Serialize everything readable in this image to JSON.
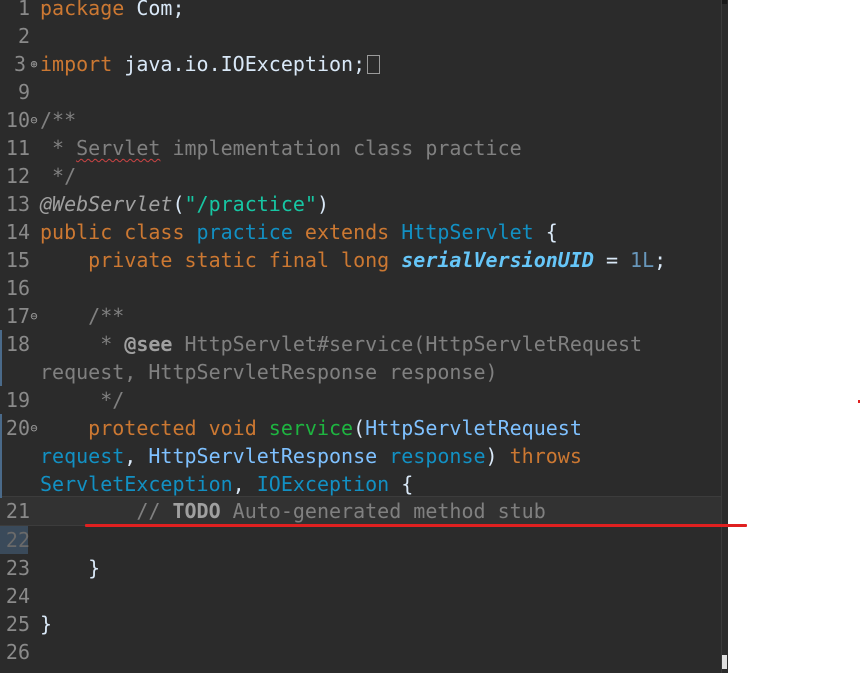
{
  "editor": {
    "lines": {
      "l1": {
        "num": "1",
        "kw": "package",
        "rest": " Com;"
      },
      "l2": {
        "num": "2"
      },
      "l3": {
        "num": "3",
        "kw": "import",
        "rest": " java.io.IOException;"
      },
      "l9": {
        "num": "9"
      },
      "l10": {
        "num": "10",
        "doc": "/**"
      },
      "l11": {
        "num": "11",
        "doc_a": " * ",
        "doc_b": "Servlet",
        "doc_c": " implementation class practice"
      },
      "l12": {
        "num": "12",
        "doc": " */"
      },
      "l13": {
        "num": "13",
        "ann": "@WebServlet",
        "p1": "(",
        "str": "\"/practice\"",
        "p2": ")"
      },
      "l14": {
        "num": "14",
        "kw1": "public class",
        "sp1": " ",
        "cls": "practice",
        "sp2": " ",
        "kw2": "extends",
        "sp3": " ",
        "typ": "HttpServlet",
        "rest": " {"
      },
      "l15": {
        "num": "15",
        "indent": "    ",
        "kw": "private static final long",
        "sp": " ",
        "field": "serialVersionUID",
        "eq": " = ",
        "num_val": "1L",
        "semi": ";"
      },
      "l16": {
        "num": "16"
      },
      "l17": {
        "num": "17",
        "doc": "    /**"
      },
      "l18": {
        "num": "18",
        "doc_a": "     * ",
        "tag": "@see",
        "doc_b": " HttpServlet#service(HttpServletRequest",
        "cont": "request, HttpServletResponse response)"
      },
      "l19": {
        "num": "19",
        "doc": "     */"
      },
      "l20": {
        "num": "20",
        "indent": "    ",
        "kw": "protected void",
        "sp": " ",
        "fn": "service",
        "p1": "(",
        "typ1": "HttpServletRequest",
        "cont1_a": "request",
        "cont1_b": ", ",
        "cont1_typ": "HttpServletResponse",
        "cont1_sp": " ",
        "cont1_param": "response",
        "cont1_c": ") ",
        "cont1_kw": "throws",
        "cont2_typ1": "ServletException",
        "cont2_b": ", ",
        "cont2_typ2": "IOException",
        "cont2_c": " {"
      },
      "l21": {
        "num": "21",
        "indent": "        ",
        "cmt_a": "// ",
        "todo": "TODO",
        "cmt_b": " Auto-generated method stub"
      },
      "l22": {
        "num": "22"
      },
      "l23": {
        "num": "23",
        "text": "    }"
      },
      "l24": {
        "num": "24"
      },
      "l25": {
        "num": "25",
        "text": "}"
      },
      "l26": {
        "num": "26"
      }
    }
  },
  "colors": {
    "background": "#2b2b2b",
    "keyword": "#cc7832",
    "type": "#1290c3",
    "method": "#1eb540",
    "string": "#17c6a3",
    "comment": "#808080",
    "annotation_underline": "#e02020"
  },
  "icons": {
    "fold": "fold-expand-icon",
    "import_collapsed": "collapsed-block-icon"
  }
}
